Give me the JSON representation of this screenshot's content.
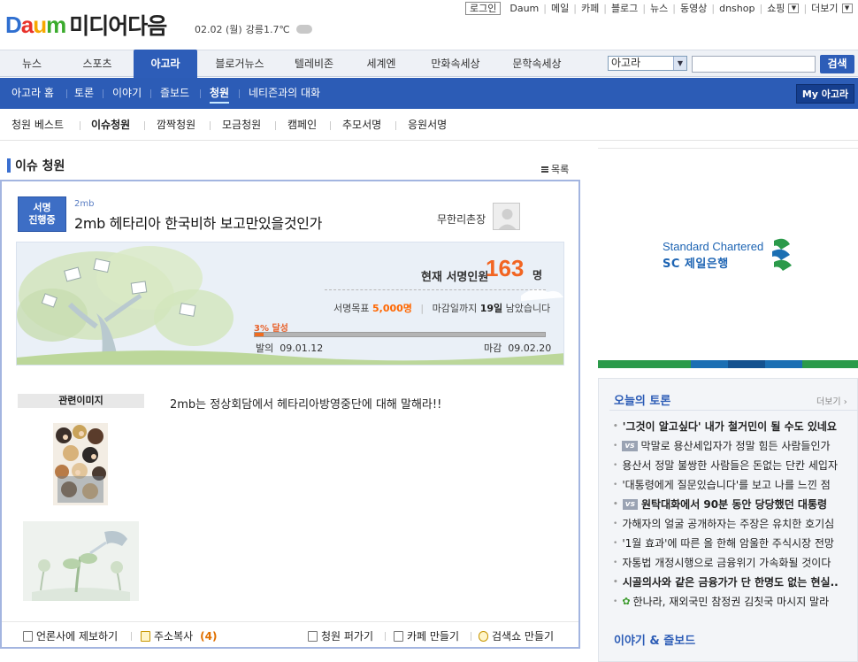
{
  "header": {
    "logo_daum": [
      "D",
      "a",
      "u",
      "m"
    ],
    "logo_text": "미디어다음",
    "date": "02.02 (월)",
    "weather": "강릉1.7℃"
  },
  "topnav": {
    "login": "로그인",
    "links": [
      "Daum",
      "메일",
      "카페",
      "블로그",
      "뉴스",
      "동영상",
      "dnshop",
      "쇼핑"
    ],
    "more": "더보기"
  },
  "mainnav": {
    "tabs": [
      "뉴스",
      "스포츠",
      "아고라",
      "블로거뉴스",
      "텔레비존",
      "세계엔",
      "만화속세상",
      "문학속세상"
    ],
    "active": "아고라",
    "search_select": "아고라",
    "search_placeholder": "",
    "search_button": "검색"
  },
  "subnav": {
    "items": [
      "아고라 홈",
      "토론",
      "이야기",
      "즐보드",
      "청원",
      "네티즌과의 대화"
    ],
    "active": "청원",
    "my": "My 아고라"
  },
  "thirdnav": {
    "items": [
      "청원 베스트",
      "이슈청원",
      "깜짝청원",
      "모금청원",
      "캠페인",
      "추모서명",
      "응원서명"
    ],
    "active": "이슈청원"
  },
  "section": {
    "title": "이슈 청원",
    "list_link": "목록"
  },
  "petition": {
    "badge_l1": "서명",
    "badge_l2": "진행중",
    "small_name": "2mb",
    "title": "2mb 헤타리아 한국비하 보고만있을것인가",
    "author": "무한리촌장",
    "count_label": "현재 서명인원",
    "count": "163",
    "count_unit": "명",
    "goal_label": "서명목표",
    "goal": "5,000명",
    "deadline_pre": "마감일까지",
    "deadline_days": "19일",
    "deadline_post": "남았습니다",
    "progress_label": "3% 달성",
    "progress": 0.03,
    "start_label": "발의",
    "start_date": "09.01.12",
    "end_label": "마감",
    "end_date": "09.02.20",
    "related_images": "관련이미지",
    "body": "2mb는 정상회담에서 헤타리아방영중단에 대해 말해라!!"
  },
  "footer": {
    "report": "언론사에 제보하기",
    "copy": "주소복사",
    "copy_count": "(4)",
    "spread": "청원 퍼가기",
    "cafe": "카페 만들기",
    "searchshow": "검색쇼 만들기"
  },
  "ad": {
    "line1": "Standard Chartered",
    "line2": "SC 제일은행",
    "bar_colors": [
      "#2b9a4a",
      "#2b9a4a",
      "#1b6fb3",
      "#14528f",
      "#1b6fb3",
      "#2b9a4a"
    ]
  },
  "debate": {
    "title": "오늘의 토론",
    "more": "더보기",
    "items": [
      {
        "text": "'그것이 알고싶다' 내가 철거민이 될 수도 있네요",
        "bold": true,
        "vs": false,
        "leaf": false
      },
      {
        "text": "막말로 용산세입자가 정말 힘든 사람들인가",
        "bold": false,
        "vs": true,
        "leaf": false
      },
      {
        "text": "용산서 정말 불쌍한 사람들은 돈없는 단칸 세입자",
        "bold": false,
        "vs": false,
        "leaf": false
      },
      {
        "text": "'대통령에게 질문있습니다'를 보고 나를 느낀 점",
        "bold": false,
        "vs": false,
        "leaf": false
      },
      {
        "text": "원탁대화에서 90분 동안 당당했던 대통령",
        "bold": true,
        "vs": true,
        "leaf": false
      },
      {
        "text": "가해자의 얼굴 공개하자는 주장은 유치한 호기심",
        "bold": false,
        "vs": false,
        "leaf": false
      },
      {
        "text": "'1월 효과'에 따른 올 한해 암울한 주식시장 전망",
        "bold": false,
        "vs": false,
        "leaf": false
      },
      {
        "text": "자통법 개정시행으로 금융위기 가속화될 것이다",
        "bold": false,
        "vs": false,
        "leaf": false
      },
      {
        "text": "시골의사와 같은 금융가가 단 한명도 없는 현실..",
        "bold": true,
        "vs": false,
        "leaf": false
      },
      {
        "text": "한나라, 재외국민 참정권 김칫국 마시지 말라",
        "bold": false,
        "vs": false,
        "leaf": true
      }
    ],
    "vs_label": "vs",
    "story_title": "이야기 & 즐보드"
  }
}
